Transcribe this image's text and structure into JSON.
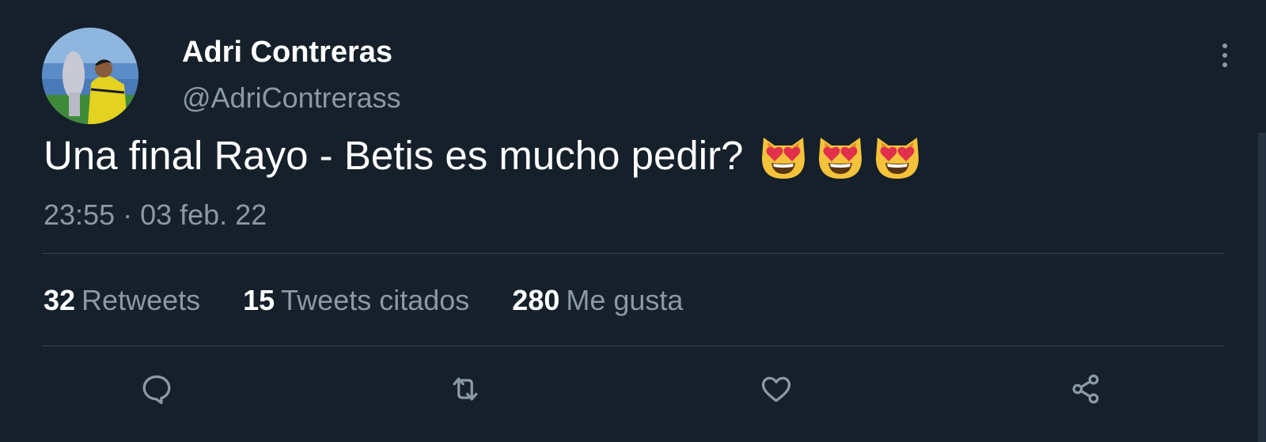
{
  "author": {
    "display_name": "Adri Contreras",
    "handle": "@AdriContrerass",
    "avatar_icon": "avatar-photo"
  },
  "tweet": {
    "text": "Una final Rayo - Betis es mucho pedir?",
    "emojis": [
      "smiling-cat-heart-eyes",
      "smiling-cat-heart-eyes",
      "smiling-cat-heart-eyes"
    ],
    "timestamp": "23:55 · 03 feb. 22"
  },
  "stats": {
    "retweets": {
      "count": "32",
      "label": "Retweets"
    },
    "quotes": {
      "count": "15",
      "label": "Tweets citados"
    },
    "likes": {
      "count": "280",
      "label": "Me gusta"
    }
  },
  "actions": {
    "reply_icon": "reply-icon",
    "retweet_icon": "retweet-icon",
    "like_icon": "like-icon",
    "share_icon": "share-icon",
    "icon_color": "#8b98a5"
  },
  "colors": {
    "background": "#15202b",
    "primary_text": "#ffffff",
    "secondary_text": "#8b98a5",
    "divider": "#38444d"
  }
}
